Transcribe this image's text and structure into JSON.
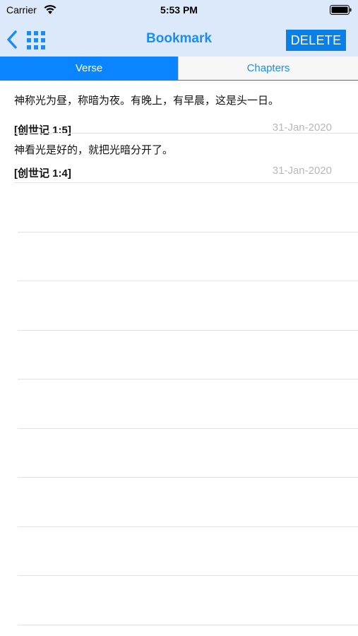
{
  "status_bar": {
    "carrier": "Carrier",
    "time": "5:53 PM"
  },
  "nav": {
    "title": "Bookmark",
    "delete_label": "DELETE",
    "back_icon": "chevron-left-icon",
    "grid_icon": "grid-icon"
  },
  "tabs": [
    {
      "label": "Verse",
      "selected": true
    },
    {
      "label": "Chapters",
      "selected": false
    }
  ],
  "bookmarks": [
    {
      "text": "神称光为昼，称暗为夜。有晚上，有早晨，这是头一日。",
      "reference": "[创世记 1:5]",
      "date": "31-Jan-2020"
    },
    {
      "text": "神看光是好的，就把光暗分开了。",
      "reference": "[创世记 1:4]",
      "date": "31-Jan-2020"
    }
  ],
  "colors": {
    "accent": "#0a84ff",
    "nav_background": "#dbe9fb",
    "title": "#1b8df0",
    "date": "#b8b8b8"
  }
}
